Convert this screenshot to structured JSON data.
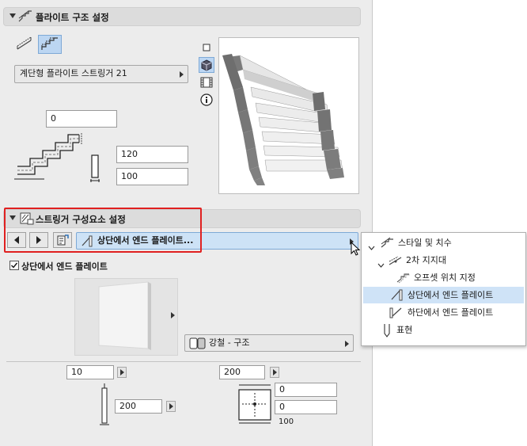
{
  "flight_section": {
    "title": "플라이트 구조 설정",
    "flight_type": "계단형 플라이트 스트링거 21",
    "offset_value": "0",
    "height_value": "120",
    "thickness_value": "100"
  },
  "stringer_section": {
    "title": "스트링거 구성요소 설정",
    "component_selected": "상단에서 엔드 플레이트...",
    "checkbox_label": "상단에서 엔드 플레이트",
    "checkbox_checked": true,
    "material": "강철 - 구조",
    "width_value": "10",
    "length_value": "200",
    "height2_value": "200",
    "offset_a": "0",
    "offset_b": "0",
    "offset_c_label": "100"
  },
  "tree_menu": {
    "items": [
      {
        "label": "스타일 및 치수"
      },
      {
        "label": "2차 지지대"
      },
      {
        "label": "오프셋 위치 지정"
      },
      {
        "label": "상단에서 엔드 플레이트",
        "selected": true
      },
      {
        "label": "하단에서 엔드 플레이트"
      },
      {
        "label": "표현"
      }
    ]
  },
  "colors": {
    "panel": "#ececec",
    "highlight": "#cfe3f7",
    "dropdown_active": "#cde2f6",
    "annotation": "#e02020"
  }
}
